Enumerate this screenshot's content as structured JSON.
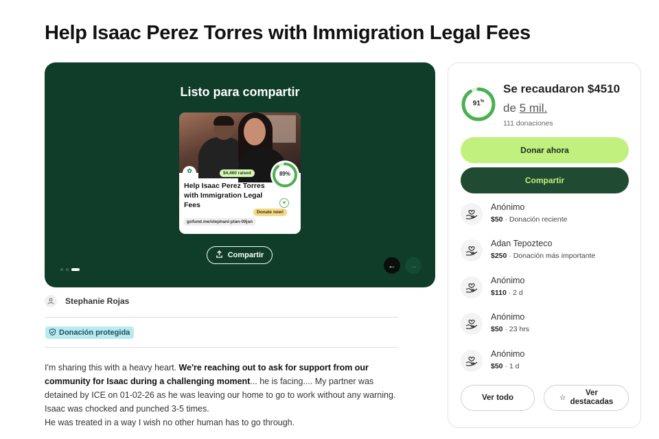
{
  "page": {
    "title": "Help Isaac Perez Torres with Immigration Legal Fees"
  },
  "hero": {
    "heading": "Listo para compartir",
    "card": {
      "raised_tag": "$4,460 raised",
      "progress_label": "89%",
      "progress": 0.89,
      "title": "Help Isaac Perez Torres with Immigration Legal Fees",
      "donate_chip": "Donate now!",
      "url": "gofund.me/stephani-plan-09jan"
    },
    "share_button": "Compartir",
    "slides": {
      "count": 3,
      "active": 3
    },
    "icons": {
      "share": "upload-icon",
      "prev": "arrow-left-icon",
      "next": "arrow-right-icon"
    }
  },
  "organizer": {
    "name": "Stephanie Rojas",
    "icon": "person-icon"
  },
  "protected": {
    "label": "Donación protegida",
    "icon": "shield-icon"
  },
  "story": {
    "p1_intro": "I'm sharing this with a heavy heart. ",
    "p1_bold": "We're reaching out to ask for support from our community for Isaac during a challenging moment",
    "p1_rest": "... he is facing.... My partner was detained by ICE on 01-02-26 as he was leaving our home to go to work without any warning. Isaac was chocked and punched 3-5 times.",
    "p2": "He was treated in a way I wish no other human has to go through."
  },
  "sidebar": {
    "percent_label": "91",
    "percent_sign": "%",
    "progress": 0.91,
    "raised": "Se recaudaron $4510",
    "goal_prefix": "de ",
    "goal_amount": "5 mil.",
    "donations": "111 donaciones",
    "donate_button": "Donar ahora",
    "share_button": "Compartir",
    "donors": [
      {
        "name": "Anónimo",
        "amount": "$50",
        "note": " · Donación reciente"
      },
      {
        "name": "Adan Tepozteco",
        "amount": "$250",
        "note": " · Donación más importante"
      },
      {
        "name": "Anónimo",
        "amount": "$110",
        "note": " · 2 d"
      },
      {
        "name": "Anónimo",
        "amount": "$50",
        "note": " · 23 hrs"
      },
      {
        "name": "Anónimo",
        "amount": "$50",
        "note": " · 1 d"
      }
    ],
    "see_all": "Ver todo",
    "see_featured_line1": "Ver",
    "see_featured_line2": "destacadas"
  },
  "colors": {
    "hero_bg": "#0f3d29",
    "accent_green": "#c2f07e",
    "dark_green": "#204a31",
    "ring_green": "#4caf50",
    "badge_blue": "#b9eaf0"
  }
}
